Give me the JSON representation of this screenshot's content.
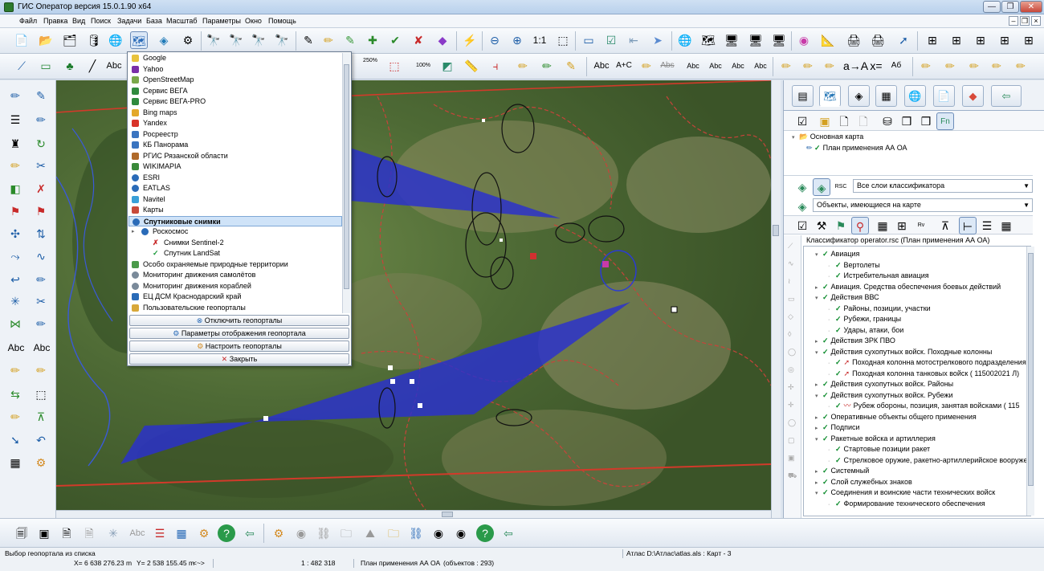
{
  "window": {
    "title": "ГИС Оператор версия 15.0.1.90 x64",
    "minimize": "—",
    "maximize": "❐",
    "close": "✕"
  },
  "menu": [
    "Файл",
    "Правка",
    "Вид",
    "Поиск",
    "Задачи",
    "База",
    "Масштаб",
    "Параметры",
    "Окно",
    "Помощь"
  ],
  "toolbar": {
    "scale_1_1": "1:1",
    "zoom_250": "250%",
    "zoom_100": "100%",
    "text_abc": "Abc",
    "text_ac": "A+C",
    "text_abs": "Abs",
    "text_ab": "Aб"
  },
  "geoportal_menu": {
    "items": [
      {
        "label": "Google",
        "color": "#e8c33c"
      },
      {
        "label": "Yahoo",
        "color": "#7b2fa8"
      },
      {
        "label": "OpenStreetMap",
        "color": "#7aa84a"
      },
      {
        "label": "Сервис ВЕГА",
        "color": "#2f8a3e"
      },
      {
        "label": "Сервис ВЕГА-PRO",
        "color": "#2f8a3e"
      },
      {
        "label": "Bing maps",
        "color": "#e3a82a"
      },
      {
        "label": "Yandex",
        "color": "#d8342a"
      },
      {
        "label": "Росреестр",
        "color": "#3a74c0"
      },
      {
        "label": "КБ Панорама",
        "color": "#3a74c0"
      },
      {
        "label": "РГИС Рязанской области",
        "color": "#b06a2a"
      },
      {
        "label": "WIKIMAPIA",
        "color": "#3a8a3a"
      },
      {
        "label": "ESRI",
        "color": "#2a6bb8"
      },
      {
        "label": "EATLAS",
        "color": "#2a6bb8"
      },
      {
        "label": "Navitel",
        "color": "#3aa0d8"
      },
      {
        "label": "Карты",
        "color": "#c84a3a"
      },
      {
        "label": "Спутниковые снимки",
        "color": "#2a6bb8",
        "selected": true
      },
      {
        "label": "Роскосмос",
        "color": "#2a6bb8",
        "indent": 1
      },
      {
        "label": "Снимки Sentinel-2",
        "color": "#c82a2a",
        "indent": 2,
        "mark": "✗"
      },
      {
        "label": "Спутник LandSat",
        "color": "#1a9a3a",
        "indent": 2,
        "mark": "✓"
      },
      {
        "label": "Особо охраняемые природные территории",
        "color": "#4a9a4a"
      },
      {
        "label": "Мониторинг движения самолётов",
        "color": "#7a8a9a"
      },
      {
        "label": "Мониторинг движения кораблей",
        "color": "#7a8a9a"
      },
      {
        "label": "ЕЦ ДСМ Краснодарский край",
        "color": "#2a6bb8"
      },
      {
        "label": "Пользовательские геопорталы",
        "color": "#d8a83a"
      }
    ],
    "btn_disconnect": "Отключить геопорталы",
    "btn_display_params": "Параметры отображения геопортала",
    "btn_configure": "Настроить геопорталы",
    "btn_close": "Закрыть"
  },
  "right_panel": {
    "map_tree": {
      "root": "Основная карта",
      "child": "План применения АА  ОА"
    },
    "layers_combo": "Все слои классификатора",
    "objects_combo": "Объекты, имеющиеся на карте",
    "classifier_title": "Классификатор operator.rsc (План применения АА  ОА)",
    "tree": [
      {
        "label": "Авиация",
        "level": 0,
        "expanded": true
      },
      {
        "label": "Вертолеты",
        "level": 1
      },
      {
        "label": "Истребительная авиация",
        "level": 1
      },
      {
        "label": "Авиация. Средства обеспечения боевых действий",
        "level": 0
      },
      {
        "label": "Действия ВВС",
        "level": 0,
        "expanded": true
      },
      {
        "label": "Районы, позиции, участки",
        "level": 1
      },
      {
        "label": "Рубежи, границы",
        "level": 1
      },
      {
        "label": "Удары, атаки, бои",
        "level": 1
      },
      {
        "label": "Действия ЗРК ПВО",
        "level": 0
      },
      {
        "label": "Действия сухопутных войск. Походные колонны",
        "level": 0,
        "expanded": true
      },
      {
        "label": "Походная колонна мотострелкового подразделения",
        "level": 1,
        "icon": "arrow"
      },
      {
        "label": "Походная колонна танковых войск ( 115002021 Л)",
        "level": 1,
        "icon": "arrow"
      },
      {
        "label": "Действия сухопутных войск. Районы",
        "level": 0
      },
      {
        "label": "Действия сухопутных войск. Рубежи",
        "level": 0,
        "expanded": true
      },
      {
        "label": "Рубеж обороны, позиция, занятая войсками ( 115",
        "level": 1,
        "icon": "line"
      },
      {
        "label": "Оперативные объекты общего применения",
        "level": 0
      },
      {
        "label": "Подписи",
        "level": 0
      },
      {
        "label": "Ракетные войска и артиллерия",
        "level": 0,
        "expanded": true
      },
      {
        "label": "Стартовые позиции ракет",
        "level": 1
      },
      {
        "label": "Стрелковое оружие, ракетно-артиллерийское вооружение",
        "level": 1
      },
      {
        "label": "Системный",
        "level": 0
      },
      {
        "label": "Слой служебных знаков",
        "level": 0
      },
      {
        "label": "Соединения и воинские части технических войск",
        "level": 0,
        "expanded": true
      },
      {
        "label": "Формирование технического обеспечения",
        "level": 1
      }
    ]
  },
  "status": {
    "hint": "Выбор геопортала из списка",
    "x": "X= 6 638 276.23 m",
    "y": "Y= 2 538 155.45 m",
    "arrows": "<~>",
    "scale": "1 : 482 318",
    "plan": "План применения АА  ОА",
    "objects": "(объектов : 293)",
    "atlas": "Атлас D:\\Атлас\\atlas.als : Карт - 3"
  },
  "colors": {
    "arrow_fill": "#2a2fd0",
    "boundary": "#c8433a",
    "selected_bg": "#cfe3f8"
  }
}
